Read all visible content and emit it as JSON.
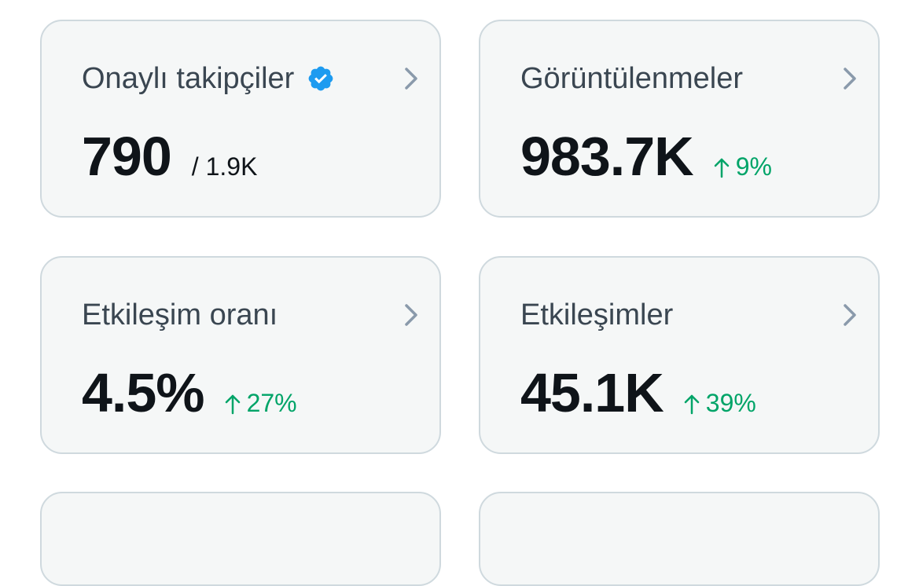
{
  "cards": [
    {
      "title": "Onaylı takipçiler",
      "value": "790",
      "total": "/ 1.9K",
      "has_verified_badge": true
    },
    {
      "title": "Görüntülenmeler",
      "value": "983.7K",
      "change": "9%",
      "change_direction": "up"
    },
    {
      "title": "Etkileşim oranı",
      "value": "4.5%",
      "change": "27%",
      "change_direction": "up"
    },
    {
      "title": "Etkileşimler",
      "value": "45.1K",
      "change": "39%",
      "change_direction": "up"
    }
  ],
  "colors": {
    "card_background": "#f5f7f7",
    "card_border": "#cfd9de",
    "title_text": "#3a4651",
    "value_text": "#0f1419",
    "positive_change": "#00a468",
    "verified_badge": "#1d9bf0",
    "chevron": "#8a9aab"
  },
  "icons": {
    "verified": "verified-badge-icon",
    "chevron": "chevron-right-icon",
    "trend": "arrow-up-icon"
  }
}
